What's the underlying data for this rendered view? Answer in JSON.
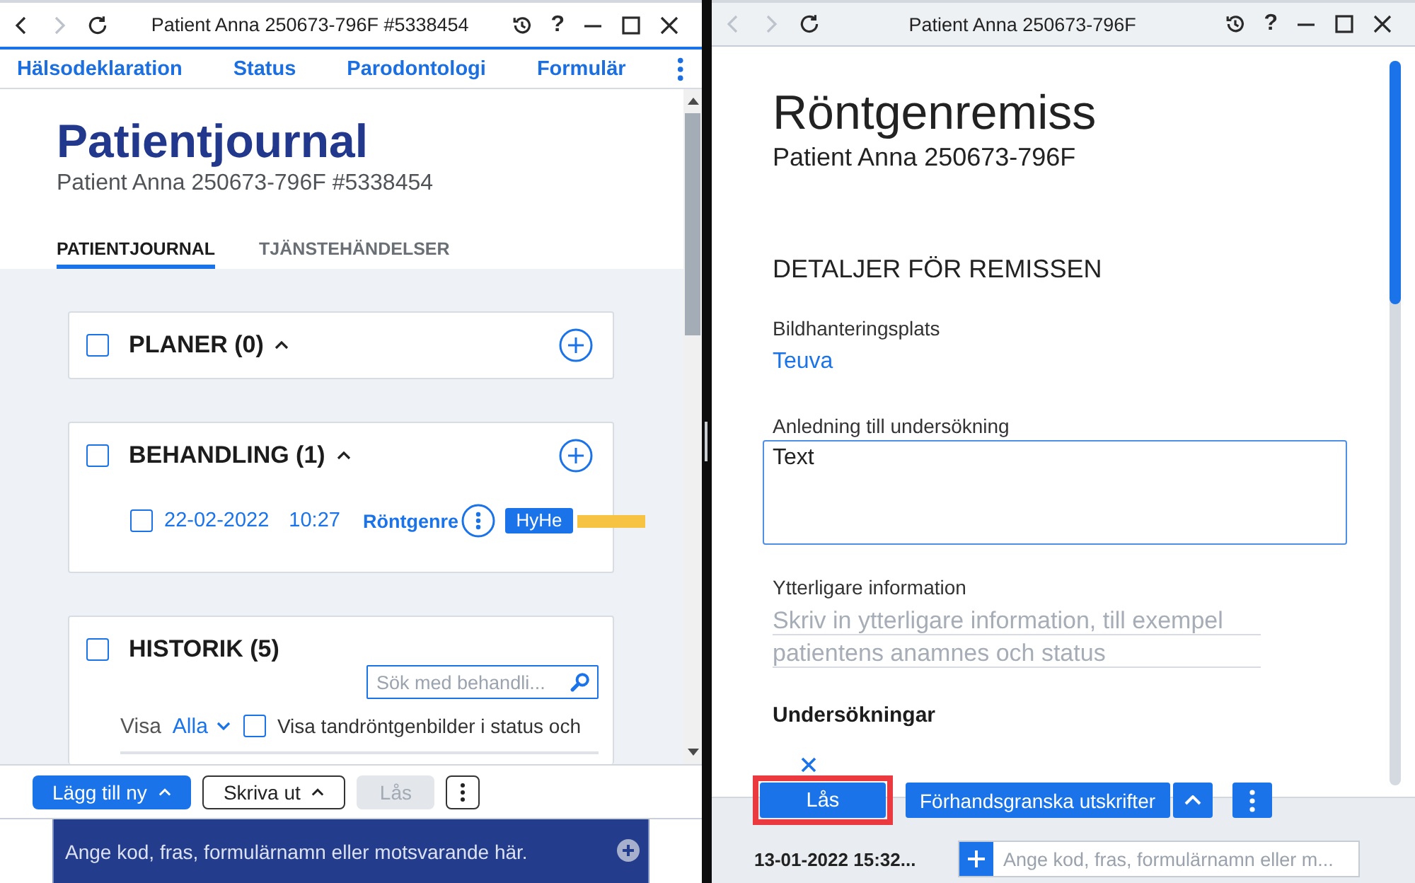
{
  "left_window": {
    "title": "Patient Anna 250673-796F #5338454",
    "nav": [
      {
        "kind": "back",
        "disabled": false
      },
      {
        "kind": "forward",
        "disabled": true
      },
      {
        "kind": "reload",
        "disabled": false
      }
    ],
    "help": "?",
    "menu": [
      "Hälsodeklaration",
      "Status",
      "Parodontologi",
      "Formulär"
    ],
    "page_title": "Patientjournal",
    "subtitle": "Patient Anna 250673-796F #5338454",
    "tabs": [
      {
        "label": "PATIENTJOURNAL",
        "selected": true
      },
      {
        "label": "TJÄNSTEHÄNDELSER",
        "selected": false
      }
    ],
    "sections": [
      {
        "kind": "group",
        "title": "PLANER (0)",
        "checked": false,
        "expanded": true
      },
      {
        "kind": "group",
        "title": "BEHANDLING (1)",
        "checked": false,
        "expanded": true,
        "entries": [
          {
            "checked": false,
            "date": "22-02-2022",
            "time": "10:27",
            "name": "Röntgenre",
            "badge": "HyHe",
            "color": "#f6c343"
          }
        ]
      },
      {
        "kind": "history",
        "title": "HISTORIK (5)",
        "checked": false,
        "search": {
          "placeholder": "Sök med behandli..."
        },
        "filter": {
          "label": "Visa",
          "value": "Alla"
        },
        "option": {
          "label": "Visa tandröntgenbilder i status och",
          "checked": false
        }
      }
    ],
    "toolbar": [
      {
        "kind": "primary",
        "label": "Lägg till ny",
        "dropdown": true,
        "disabled": false
      },
      {
        "kind": "outline",
        "label": "Skriva ut",
        "dropdown": true,
        "disabled": false
      },
      {
        "kind": "primary",
        "label": "Lås",
        "dropdown": false,
        "disabled": true
      },
      {
        "kind": "more",
        "disabled": false
      }
    ],
    "command_field": {
      "placeholder": "Ange kod, fras, formulärnamn eller motsvarande här."
    }
  },
  "right_window": {
    "title": "Patient Anna 250673-796F",
    "nav": [
      {
        "kind": "back",
        "disabled": true
      },
      {
        "kind": "forward",
        "disabled": true
      },
      {
        "kind": "reload",
        "disabled": false
      }
    ],
    "help": "?",
    "page_title": "Röntgenremiss",
    "subtitle": "Patient Anna 250673-796F",
    "section_title": "DETALJER FÖR REMISSEN",
    "fields": [
      {
        "kind": "link",
        "label": "Bildhanteringsplats",
        "value": "Teuva"
      },
      {
        "kind": "textarea",
        "label": "Anledning till undersökning",
        "value": "Text"
      },
      {
        "kind": "inline",
        "label": "Ytterligare information",
        "placeholder": "Skriv in ytterligare information, till exempel patientens anamnes och status"
      }
    ],
    "exams_title": "Undersökningar",
    "toolbar": [
      {
        "kind": "primary",
        "label": "Lås",
        "highlighted": true
      },
      {
        "kind": "split",
        "label": "Förhandsgranska utskrifter",
        "highlighted": false
      },
      {
        "kind": "more",
        "highlighted": false
      }
    ],
    "status": {
      "timestamp": "13-01-2022 15:32..."
    },
    "command_field": {
      "placeholder": "Ange kod, fras, formulärnamn eller m..."
    }
  }
}
